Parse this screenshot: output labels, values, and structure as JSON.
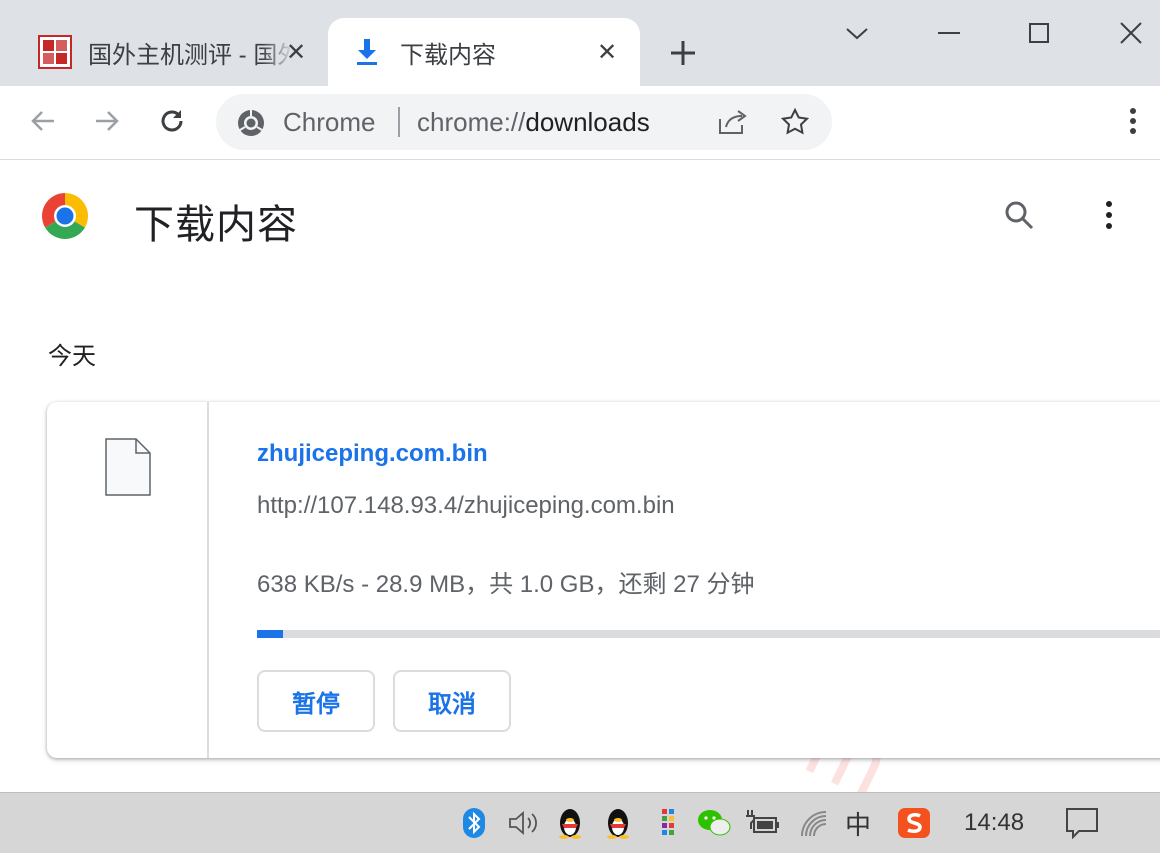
{
  "browser": {
    "tabs": [
      {
        "title": "国外主机测评 - 国外",
        "close": "✕"
      },
      {
        "title": "下载内容",
        "close": "✕"
      }
    ],
    "omnibox": {
      "chip_label": "Chrome",
      "url_scheme": "chrome://",
      "url_path": "downloads"
    }
  },
  "page": {
    "title": "下载内容",
    "section_date": "今天",
    "watermark": "zhujiceping.com",
    "download": {
      "file_name": "zhujiceping.com.bin",
      "url": "http://107.148.93.4/zhujiceping.com.bin",
      "status": "638 KB/s - 28.9 MB，共 1.0 GB，还剩 27 分钟",
      "progress": 0.028,
      "pause_label": "暂停",
      "cancel_label": "取消"
    }
  },
  "taskbar": {
    "ime": "中",
    "clock": "14:48"
  },
  "colors": {
    "accent": "#1a73e8",
    "tabstrip": "#dee1e6",
    "omnibox": "#f1f3f4",
    "taskbar": "#d6d6d6"
  }
}
